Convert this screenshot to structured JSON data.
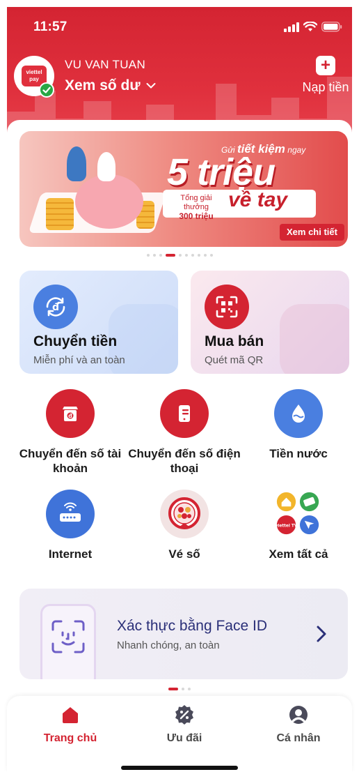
{
  "status_bar": {
    "time": "11:57"
  },
  "header": {
    "user_name": "VU VAN TUAN",
    "balance_label": "Xem số dư",
    "topup_label": "Nạp tiền",
    "avatar_brand": "viettel pay"
  },
  "banner": {
    "small_text": "Gửi",
    "small_emphasis": "tiết kiệm",
    "small_suffix": "ngay",
    "big_text": "5 triệu",
    "prize_label": "Tổng giải thưởng",
    "prize_value": "300 triệu",
    "tagline": "về tay",
    "cta": "Xem chi tiết",
    "dot_count": 10,
    "active_dot": 3
  },
  "cards": [
    {
      "title": "Chuyển tiền",
      "subtitle": "Miễn phí và an toàn",
      "icon": "transfer-dong-icon"
    },
    {
      "title": "Mua bán",
      "subtitle": "Quét mã QR",
      "icon": "qr-scan-icon"
    }
  ],
  "services": [
    {
      "label": "Chuyển đến số tài khoản",
      "icon": "bank-account-icon"
    },
    {
      "label": "Chuyển đến số điện thoại",
      "icon": "phone-transfer-icon"
    },
    {
      "label": "Tiền nước",
      "icon": "water-drop-icon"
    },
    {
      "label": "Internet",
      "icon": "router-icon"
    },
    {
      "label": "Vé số",
      "icon": "lottery-wheel-icon"
    },
    {
      "label": "Xem tất cả",
      "icon": "view-all-icon"
    }
  ],
  "faceid": {
    "title": "Xác thực bằng Face ID",
    "subtitle": "Nhanh chóng, an toàn",
    "dot_count": 3,
    "active_dot": 0
  },
  "bottom_nav": [
    {
      "label": "Trang chủ",
      "icon": "home-icon",
      "active": true
    },
    {
      "label": "Ưu đãi",
      "icon": "discount-badge-icon",
      "active": false
    },
    {
      "label": "Cá nhân",
      "icon": "profile-icon",
      "active": false
    }
  ],
  "colors": {
    "brand_red": "#d42432",
    "transfer_blue": "#4a7fe0",
    "water_blue": "#4a7fe0",
    "internet_blue": "#3f73d9",
    "faceid_title": "#2a2f78"
  }
}
